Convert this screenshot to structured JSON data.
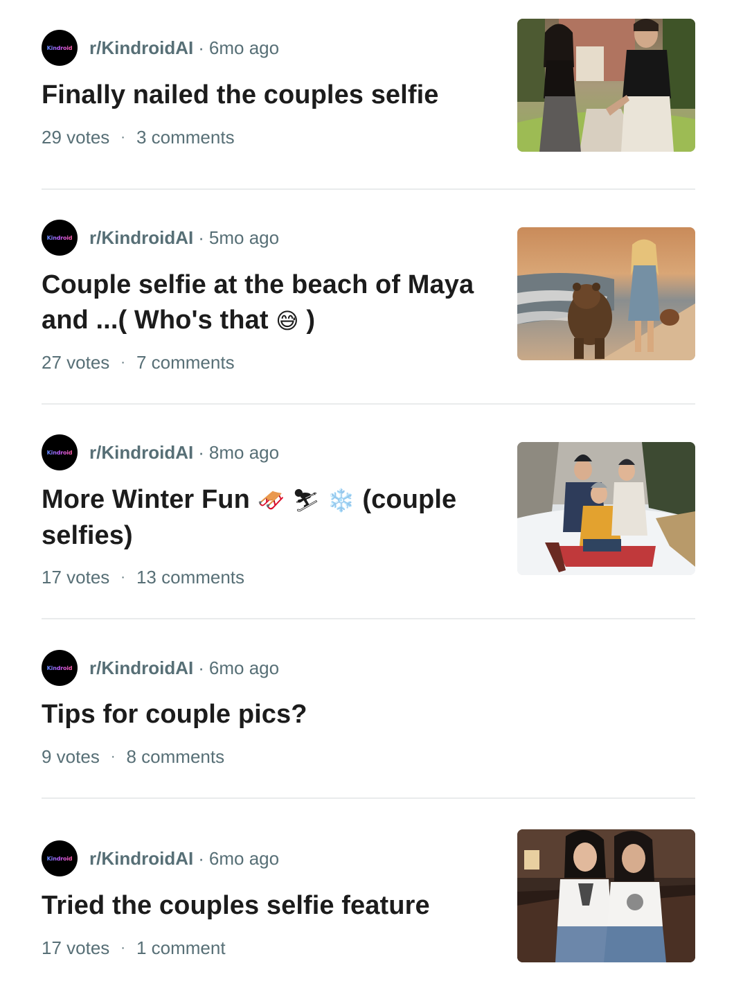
{
  "posts": [
    {
      "avatar_text": "Kindroid",
      "subreddit": "r/KindroidAI",
      "separator": "·",
      "time": "6mo ago",
      "title": "Finally nailed the couples selfie",
      "votes": "29 votes",
      "stat_separator": "·",
      "comments": "3 comments",
      "thumbnail": "couple walking holding hands"
    },
    {
      "avatar_text": "Kindroid",
      "subreddit": "r/KindroidAI",
      "separator": "·",
      "time": "5mo ago",
      "title_line1": "Couple selfie at the beach of Maya",
      "title_line2": "and ...( Who's that",
      "title_emoji": "😅",
      "title_line2_end": " )",
      "votes": "27 votes",
      "stat_separator": "·",
      "comments": "7 comments",
      "thumbnail": "woman and bear on beach at sunset"
    },
    {
      "avatar_text": "Kindroid",
      "subreddit": "r/KindroidAI",
      "separator": "·",
      "time": "8mo ago",
      "title_line1_start": "More Winter Fun",
      "title_emojis": "🛷 ⛷ ❄️",
      "title_line1_end": "(couple",
      "title_line2": "selfies)",
      "votes": "17 votes",
      "stat_separator": "·",
      "comments": "13 comments",
      "thumbnail": "people sledding in snow"
    },
    {
      "avatar_text": "Kindroid",
      "subreddit": "r/KindroidAI",
      "separator": "·",
      "time": "6mo ago",
      "title": "Tips for couple pics?",
      "votes": "9 votes",
      "stat_separator": "·",
      "comments": "8 comments"
    },
    {
      "avatar_text": "Kindroid",
      "subreddit": "r/KindroidAI",
      "separator": "·",
      "time": "6mo ago",
      "title": "Tried the couples selfie feature",
      "votes": "17 votes",
      "stat_separator": "·",
      "comments": "1 comment",
      "thumbnail": "couple sitting on leather couch"
    }
  ]
}
